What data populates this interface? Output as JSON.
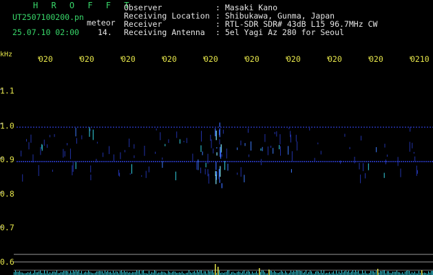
{
  "header": {
    "title": "H R O F F T",
    "file": "UT2507100200.pn",
    "meteor": "meteor",
    "datetime": "25.07.10 02:00",
    "count": "14."
  },
  "info": [
    {
      "label": "Observer",
      "value": ": Masaki Kano"
    },
    {
      "label": "Receiving Location",
      "value": ": Shibukawa, Gunma, Japan"
    },
    {
      "label": "Receiver",
      "value": ": RTL-SDR SDR# 43dB L15 96.7MHz CW"
    },
    {
      "label": "Receiving Antenna",
      "value": ": 5el Yagi Az 280 for Seoul"
    }
  ],
  "axis": {
    "y_unit": "kHz",
    "x_ticks": [
      "020",
      "020",
      "020",
      "020",
      "020",
      "020",
      "020",
      "020",
      "020",
      "0210"
    ],
    "y_ticks": [
      "1.1",
      "1.0",
      "0.9",
      "0.8",
      "0.7",
      "0.6"
    ]
  },
  "colors": {
    "header_green": "#38d86a",
    "label_white": "#e6e6e6",
    "tick_yellow": "#e6e64a",
    "trace_blue": "#2f3fd8",
    "echo_cyan": "#35d6e6"
  }
}
